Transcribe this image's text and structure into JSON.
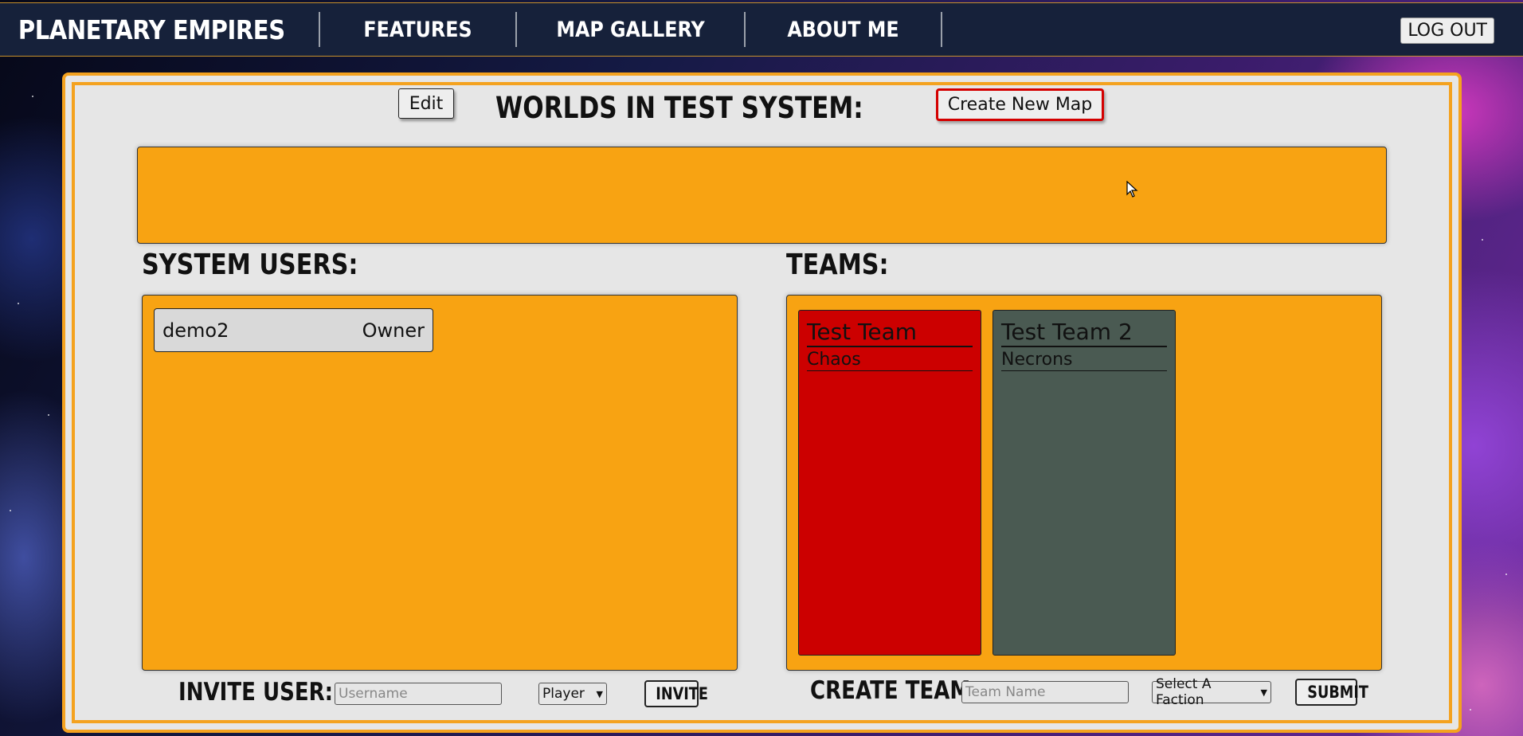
{
  "nav": {
    "brand": "PLANETARY EMPIRES",
    "items": [
      {
        "label": "FEATURES"
      },
      {
        "label": "MAP GALLERY"
      },
      {
        "label": "ABOUT ME"
      }
    ],
    "logout_label": "LOG OUT"
  },
  "header": {
    "edit_label": "Edit",
    "title": "WORLDS IN TEST SYSTEM:",
    "create_map_label": "Create New Map"
  },
  "users": {
    "title": "SYSTEM USERS:",
    "items": [
      {
        "name": "demo2",
        "role": "Owner"
      }
    ]
  },
  "teams": {
    "title": "TEAMS:",
    "items": [
      {
        "name": "Test Team",
        "faction": "Chaos",
        "color": "#cc0000"
      },
      {
        "name": "Test Team 2",
        "faction": "Necrons",
        "color": "#4a5a52"
      }
    ]
  },
  "invite_form": {
    "label": "INVITE USER:",
    "username_placeholder": "Username",
    "role_selected": "Player",
    "button_label": "INVITE"
  },
  "team_form": {
    "label": "CREATE TEAM:",
    "team_name_placeholder": "Team Name",
    "faction_selected": "Select A Faction",
    "button_label": "SUBMIT"
  },
  "colors": {
    "accent": "#f8a312",
    "nav_bg": "#16213a",
    "panel_bg": "#e6e6e6",
    "create_border": "#d40000"
  }
}
